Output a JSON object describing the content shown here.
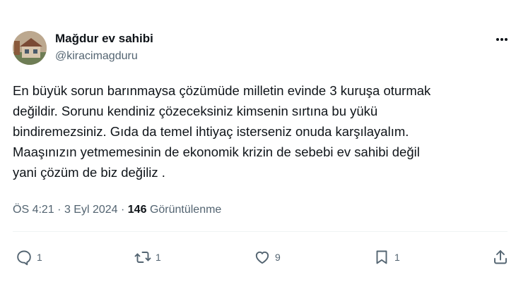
{
  "author": {
    "display_name": "Mağdur ev sahibi",
    "handle": "@kiracimagduru",
    "avatar_icon": "house-avatar"
  },
  "tweet": {
    "text": "En büyük sorun barınmaysa çözümüde milletin evinde 3 kuruşa oturmak\ndeğildir. Sorunu kendiniz çözeceksiniz kimsenin sırtına bu yükü\nbindiremezsiniz. Gıda da temel ihtiyaç isterseniz onuda karşılayalım.\nMaaşınızın yetmemesinin de ekonomik krizin de sebebi ev sahibi değil\nyani çözüm de biz değiliz ."
  },
  "meta": {
    "time": "ÖS 4:21",
    "separator": "·",
    "date": "3 Eyl 2024",
    "views_count": "146",
    "views_label": "Görüntülenme"
  },
  "actions": {
    "reply": {
      "icon": "reply-icon",
      "count": "1"
    },
    "retweet": {
      "icon": "retweet-icon",
      "count": "1"
    },
    "like": {
      "icon": "heart-icon",
      "count": "9"
    },
    "bookmark": {
      "icon": "bookmark-icon",
      "count": "1"
    },
    "share": {
      "icon": "share-icon"
    }
  },
  "colors": {
    "text_primary": "#0f1419",
    "text_secondary": "#536471",
    "divider": "#eff3f4",
    "background": "#ffffff"
  }
}
